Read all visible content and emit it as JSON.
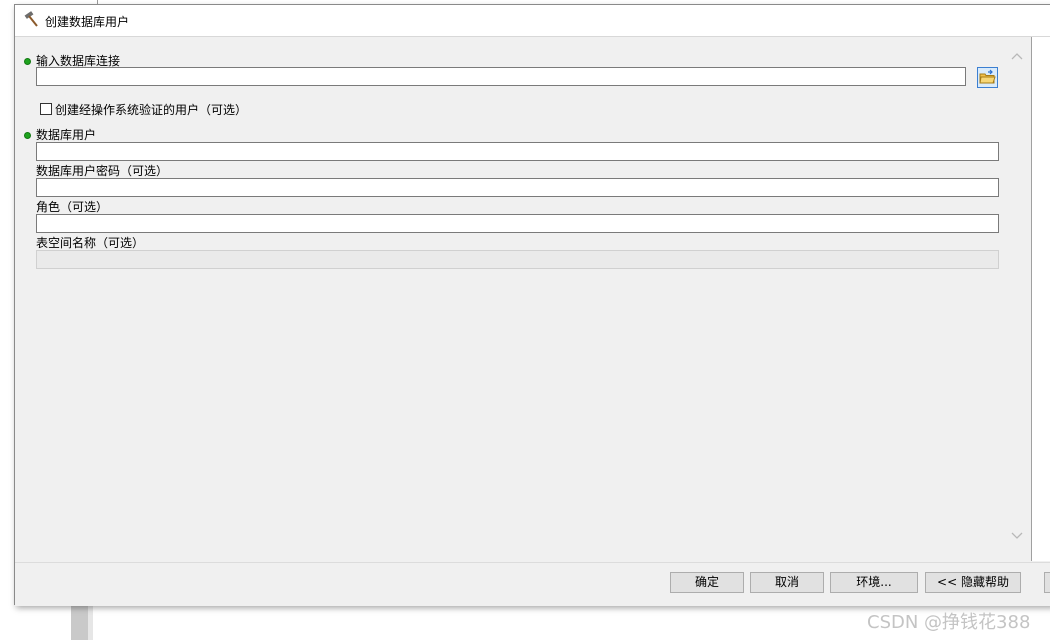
{
  "window": {
    "title": "创建数据库用户",
    "icon": "hammer-icon"
  },
  "form": {
    "input_connection": {
      "label": "输入数据库连接",
      "value": "",
      "required": true
    },
    "os_auth": {
      "label": "创建经操作系统验证的用户（可选）",
      "checked": false
    },
    "db_user": {
      "label": "数据库用户",
      "value": "",
      "required": true
    },
    "db_password": {
      "label": "数据库用户密码（可选）",
      "value": ""
    },
    "role": {
      "label": "角色（可选）",
      "value": ""
    },
    "tablespace": {
      "label": "表空间名称（可选）",
      "value": "",
      "disabled": true
    }
  },
  "buttons": {
    "ok": "确定",
    "cancel": "取消",
    "env": "环境...",
    "hide_help": "<< 隐藏帮助"
  },
  "watermark": "CSDN @挣钱花388",
  "colors": {
    "required_dot": "#1fa31f",
    "browse_border": "#3c7fd1",
    "dialog_bg": "#f0f0f0"
  }
}
